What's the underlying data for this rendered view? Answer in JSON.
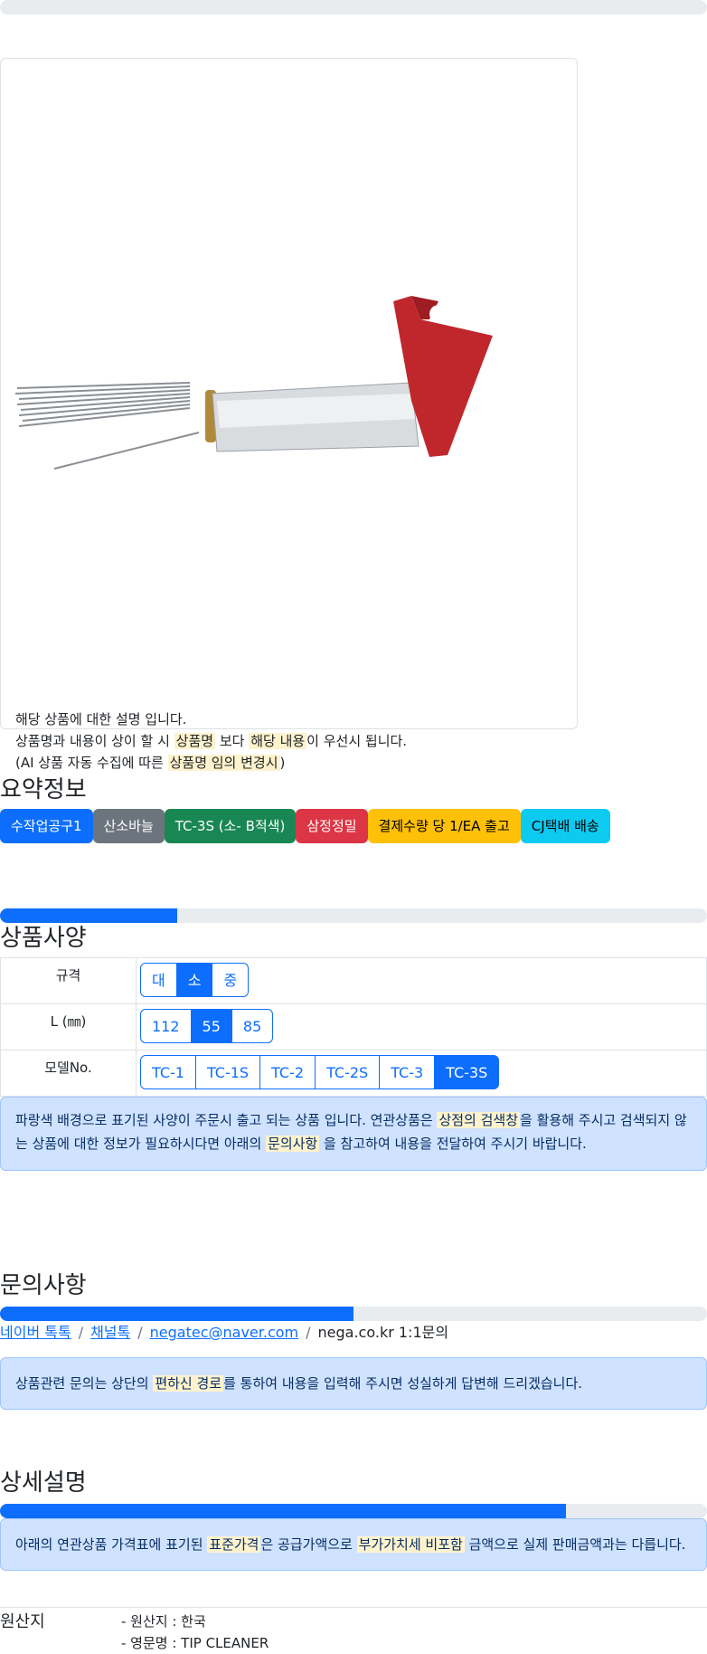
{
  "top_progress": {
    "percent": 0
  },
  "product_card": {
    "image_alt": "TIP CLEANER",
    "desc_line1": "해당 상품에 대한 설명 입니다.",
    "desc_line2_a": "상품명과 내용이 상이 할 시 ",
    "desc_line2_b": "상품명",
    "desc_line2_c": " 보다 ",
    "desc_line2_d": "해당 내용",
    "desc_line2_e": "이 우선시 됩니다.",
    "desc_line3_a": "(AI 상품 자동 수집에 따른 ",
    "desc_line3_b": "상품명 임의 변경시",
    "desc_line3_c": ")"
  },
  "summary": {
    "title": "요약정보",
    "badges": [
      {
        "label": "수작업공구1",
        "color": "#0d6efd",
        "text": "#ffffff"
      },
      {
        "label": "산소바늘",
        "color": "#6c757d",
        "text": "#ffffff"
      },
      {
        "label": "TC-3S (소- B적색)",
        "color": "#198754",
        "text": "#ffffff"
      },
      {
        "label": "삼정정밀",
        "color": "#dc3545",
        "text": "#ffffff"
      },
      {
        "label": "결제수량 당 1/EA 출고",
        "color": "#ffc107",
        "text": "#000000"
      },
      {
        "label": "CJ택배 배송",
        "color": "#0dcaf0",
        "text": "#000000"
      }
    ]
  },
  "spec": {
    "progress_percent": 25,
    "title": "상품사양",
    "rows": [
      {
        "label": "규격",
        "options": [
          "대",
          "소",
          "중"
        ],
        "selected": 1
      },
      {
        "label": "L (㎜)",
        "options": [
          "112",
          "55",
          "85"
        ],
        "selected": 1
      },
      {
        "label": "모델No.",
        "options": [
          "TC-1",
          "TC-1S",
          "TC-2",
          "TC-2S",
          "TC-3",
          "TC-3S"
        ],
        "selected": 5
      }
    ],
    "notice_a": "파랑색 배경으로 표기된 사양이 주문시 출고 되는 상품 입니다. 연관상품은 ",
    "notice_b": "상점의 검색창",
    "notice_c": "을 활용해 주시고 검색되지 않는 상품에 대한 정보가 필요하시다면 아래의 ",
    "notice_d": "문의사항",
    "notice_e": " 을 참고하여 내용을 전달하여 주시기 바랍니다."
  },
  "inquiry": {
    "title": "문의사항",
    "progress_percent": 50,
    "links": [
      "네이버 톡톡",
      "채널톡",
      "negatec@naver.com"
    ],
    "last": "nega.co.kr 1:1문의",
    "notice_a": "상품관련 문의는 상단의 ",
    "notice_b": "편하신 경로",
    "notice_c": "를 통하여 내용을 입력해 주시면 성실하게 답변해 드리겠습니다."
  },
  "detail": {
    "title": "상세설명",
    "progress_percent": 80,
    "notice_a": "아래의 연관상품 가격표에 표기된 ",
    "notice_b": "표준가격",
    "notice_c": "은 공급가액으로 ",
    "notice_d": "부가가치세 비포함",
    "notice_e": " 금액으로 실제 판매금액과는 다릅니다."
  },
  "origin": {
    "label": "원산지",
    "line1": "- 원산지 : 한국",
    "line2": "- 영문명 : TIP CLEANER"
  }
}
